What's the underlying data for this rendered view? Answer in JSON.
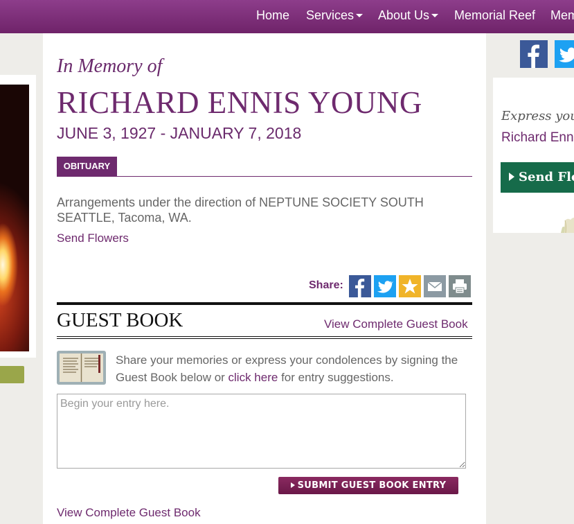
{
  "nav": {
    "items": [
      {
        "label": "Home",
        "dropdown": false
      },
      {
        "label": "Services",
        "dropdown": true
      },
      {
        "label": "About Us",
        "dropdown": true
      },
      {
        "label": "Memorial Reef",
        "dropdown": false
      },
      {
        "label": "Mem",
        "dropdown": false
      }
    ]
  },
  "memorial": {
    "heading": "In Memory of",
    "name": "RICHARD ENNIS YOUNG",
    "dates": "JUNE 3, 1927 - JANUARY 7, 2018"
  },
  "obituary": {
    "tab_label": "OBITUARY",
    "text": "Arrangements under the direction of NEPTUNE SOCIETY SOUTH SEATTLE, Tacoma, WA.",
    "send_flowers_link": "Send Flowers"
  },
  "share": {
    "label": "Share:",
    "buttons": [
      "facebook-icon",
      "twitter-icon",
      "star-icon",
      "email-icon",
      "print-icon"
    ]
  },
  "guestbook": {
    "title": "GUEST BOOK",
    "view_complete_top": "View Complete Guest Book",
    "intro_before": "Share your memories or express your condolences by signing the Guest Book below or ",
    "intro_link": "click here",
    "intro_after": " for entry suggestions.",
    "entry_placeholder": "Begin your entry here.",
    "submit_label": "SUBMIT GUEST BOOK ENTRY",
    "view_complete_bottom": "View Complete Guest Book"
  },
  "sidebar": {
    "express_text": "Express your",
    "name_text": "Richard Enn",
    "send_button": "Send Flo"
  },
  "colors": {
    "brand_purple": "#6e2a6e",
    "nav_gradient_top": "#8d3d8b",
    "nav_gradient_bottom": "#6f2369",
    "sidebar_green": "#166b4a",
    "submit_button": "#7a1f55",
    "facebook_blue": "#3b5998",
    "twitter_blue": "#1da1f2",
    "star_gold": "#f0b429",
    "email_gray": "#8c9aa3",
    "print_gray": "#7f8c8d"
  }
}
